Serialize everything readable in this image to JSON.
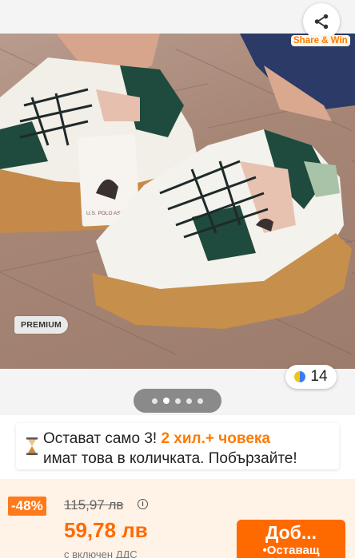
{
  "share": {
    "icon": "share-icon",
    "label": "Share & Win"
  },
  "gallery": {
    "badge": "PREMIUM",
    "reviews_count": "14",
    "pager_dots": 5,
    "active_dot": 1,
    "hang_tag_text": "U.S. POLO ASSN."
  },
  "urgency": {
    "icon": "hourglass-icon",
    "part1": "Остават само 3! ",
    "highlight": "2 хил.+ човека",
    "line2": "имат това в количката. Побързайте!"
  },
  "price": {
    "discount": "-48%",
    "old": "115,97 лв",
    "info_icon": "info-icon",
    "current": "59,78 лв",
    "vat_note": "с включен ДДС"
  },
  "cta": {
    "label": "Доб...",
    "sublabel": "•Оставащ"
  },
  "colors": {
    "accent": "#ff6a00",
    "discount_bg": "#ff7a1a",
    "bar_bg": "#fff2e6"
  }
}
